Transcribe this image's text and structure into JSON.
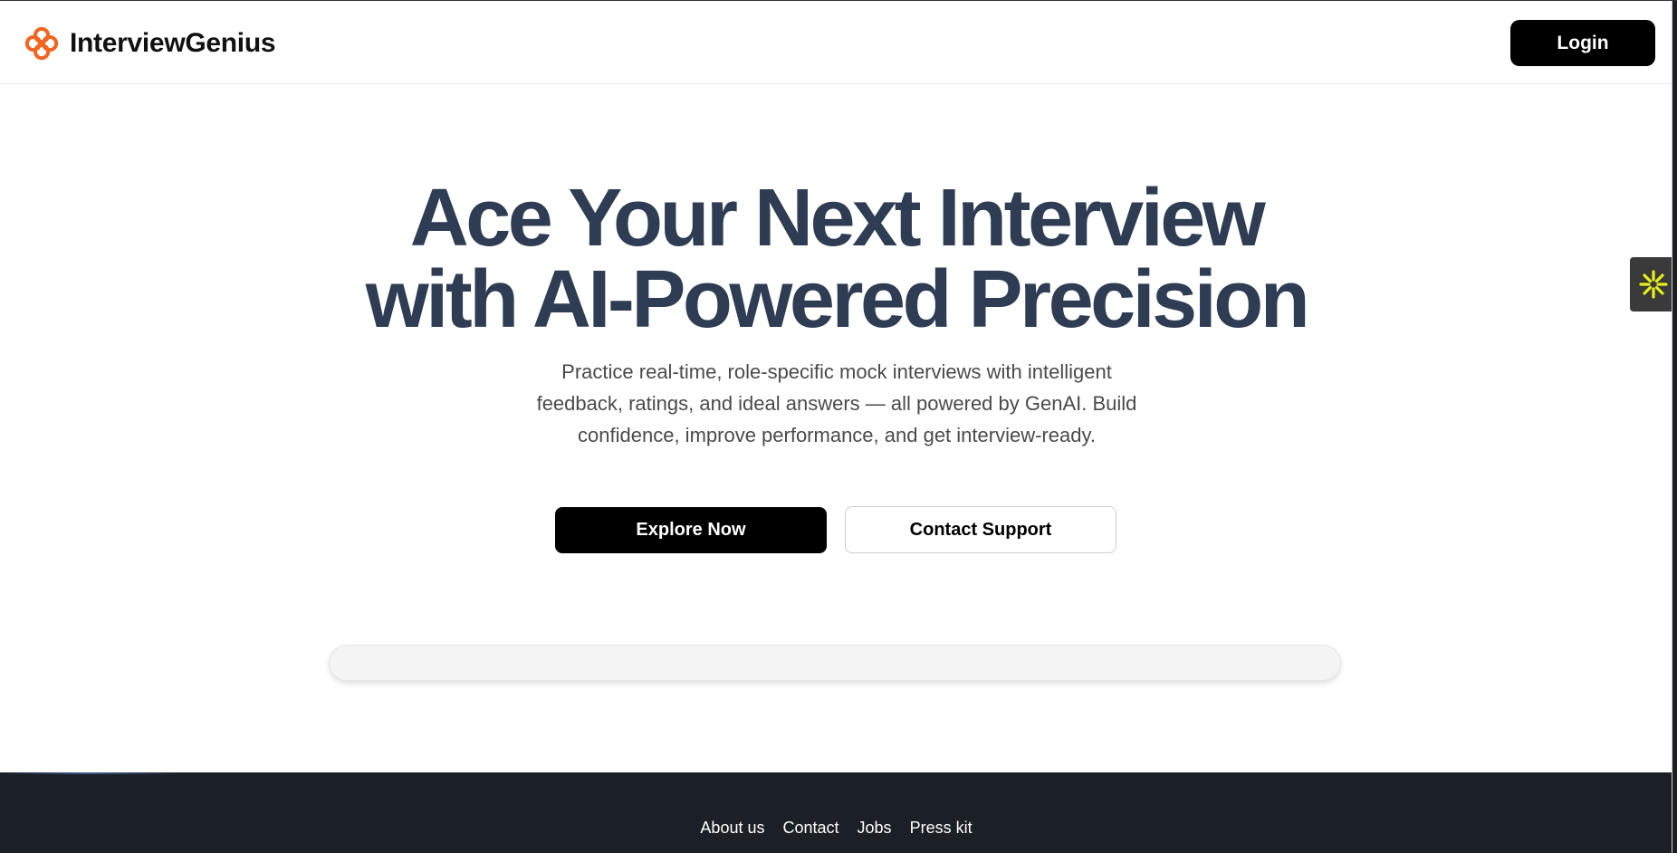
{
  "header": {
    "brand_name": "InterviewGenius",
    "brand_icon": "flower-logo-icon",
    "brand_color": "#f26522",
    "login_label": "Login"
  },
  "hero": {
    "title_line1": "Ace Your Next Interview",
    "title_line2": "with AI-Powered Precision",
    "subtitle": "Practice real-time, role-specific mock interviews with intelligent feedback, ratings, and ideal answers — all powered by GenAI. Build confidence, improve performance, and get interview-ready.",
    "primary_button": "Explore Now",
    "secondary_button": "Contact Support",
    "title_color": "#2e3d54"
  },
  "side_widget": {
    "icon": "asterisk-sparkle-icon",
    "icon_color": "#e6f01a"
  },
  "footer": {
    "links": [
      "About us",
      "Contact",
      "Jobs",
      "Press kit"
    ],
    "background": "#1b1f26"
  }
}
